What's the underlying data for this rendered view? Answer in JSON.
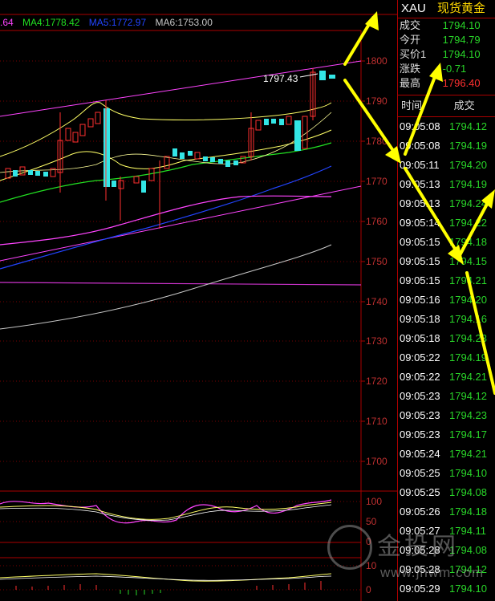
{
  "ma_legend": [
    {
      "text": ".64",
      "color": "#ff44ff"
    },
    {
      "text": "MA4:1778.42",
      "color": "#22e022"
    },
    {
      "text": "MA5:1772.97",
      "color": "#2244ff"
    },
    {
      "text": "MA6:1753.00",
      "color": "#c8c8c8"
    }
  ],
  "price_axis": [
    "1800",
    "1790",
    "1780",
    "1770",
    "1760",
    "1750",
    "1740",
    "1730",
    "1720",
    "1710",
    "1700"
  ],
  "price_callout": "1797.43",
  "osc1_axis": [
    "100",
    "50",
    "0"
  ],
  "osc2_axis": [
    "10",
    "0"
  ],
  "quote": {
    "symbol": "XAU",
    "name": "现货黄金",
    "rows": [
      {
        "label": "成交",
        "value": "1794.10",
        "color": "#29d629"
      },
      {
        "label": "今开",
        "value": "1794.79",
        "color": "#29d629"
      },
      {
        "label": "买价1",
        "value": "1794.10",
        "color": "#29d629"
      },
      {
        "label": "涨跌",
        "value": "-0.71",
        "color": "#29d629"
      },
      {
        "label": "最高",
        "value": "1796.40",
        "color": "#ff3030"
      }
    ]
  },
  "ticks_header": {
    "time": "时间",
    "price": "成交"
  },
  "ticks": [
    {
      "time": "09:05:08",
      "price": "1794.12"
    },
    {
      "time": "09:05:08",
      "price": "1794.19"
    },
    {
      "time": "09:05:11",
      "price": "1794.20"
    },
    {
      "time": "09:05:13",
      "price": "1794.19"
    },
    {
      "time": "09:05:13",
      "price": "1794.24"
    },
    {
      "time": "09:05:14",
      "price": "1794.22"
    },
    {
      "time": "09:05:15",
      "price": "1794.18"
    },
    {
      "time": "09:05:15",
      "price": "1794.15"
    },
    {
      "time": "09:05:15",
      "price": "1794.21"
    },
    {
      "time": "09:05:16",
      "price": "1794.20"
    },
    {
      "time": "09:05:18",
      "price": "1794.16"
    },
    {
      "time": "09:05:18",
      "price": "1794.23"
    },
    {
      "time": "09:05:22",
      "price": "1794.19"
    },
    {
      "time": "09:05:22",
      "price": "1794.21"
    },
    {
      "time": "09:05:23",
      "price": "1794.12"
    },
    {
      "time": "09:05:23",
      "price": "1794.23"
    },
    {
      "time": "09:05:23",
      "price": "1794.17"
    },
    {
      "time": "09:05:24",
      "price": "1794.21"
    },
    {
      "time": "09:05:25",
      "price": "1794.10"
    },
    {
      "time": "09:05:25",
      "price": "1794.08"
    },
    {
      "time": "09:05:26",
      "price": "1794.18"
    },
    {
      "time": "09:05:27",
      "price": "1794.11"
    },
    {
      "time": "09:05:28",
      "price": "1794.08"
    },
    {
      "time": "09:05:28",
      "price": "1794.12"
    },
    {
      "time": "09:05:29",
      "price": "1794.10"
    }
  ],
  "watermark": {
    "brand": "金投网",
    "url": "www.jnwm.com"
  }
}
